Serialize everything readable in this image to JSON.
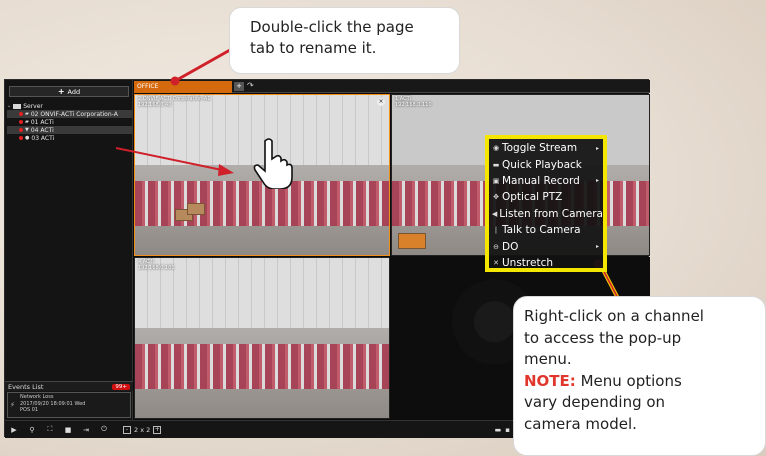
{
  "callouts": {
    "tab_hint": [
      "Double-click the page",
      "tab to rename it."
    ],
    "menu_hint": [
      "Right-click on a channel",
      "to access the pop-up",
      "menu."
    ],
    "note_label": "NOTE:",
    "note_text": [
      " Menu options",
      "vary depending on",
      "camera model."
    ]
  },
  "sidebar": {
    "add_label": "Add",
    "root_label": "Server",
    "devices": [
      {
        "label": "02 ONVIF-ACTi Corporation-A",
        "icon": "camera-icon"
      },
      {
        "label": "01 ACTi",
        "icon": "camera-icon"
      },
      {
        "label": "04 ACTi",
        "icon": "ptz-camera-icon"
      },
      {
        "label": "03 ACTi",
        "icon": "dome-camera-icon"
      }
    ]
  },
  "events": {
    "title": "Events List",
    "badge": "99+",
    "item": {
      "type": "Network Loss",
      "timestamp": "2017/09/20 18:09:01 Wed",
      "source": "POS 01"
    }
  },
  "tabs": {
    "active": "OFFICE",
    "add": "+",
    "refresh": "↷"
  },
  "channels": [
    {
      "label": "2 ONVIF-ACTi Corporation-A1",
      "sub": "192.168.0.40"
    },
    {
      "label": "1 ACTi",
      "sub": "192.168.0.110"
    },
    {
      "label": "4 ACTi",
      "sub": "192.168.0.101"
    }
  ],
  "context_menu": [
    {
      "label": "Toggle Stream",
      "icon": "stream-icon",
      "submenu": true
    },
    {
      "label": "Quick Playback",
      "icon": "playback-icon",
      "submenu": false
    },
    {
      "label": "Manual Record",
      "icon": "record-icon",
      "submenu": true
    },
    {
      "label": "Optical PTZ",
      "icon": "ptz-icon",
      "submenu": false
    },
    {
      "label": "Listen from Camera",
      "icon": "speaker-icon",
      "submenu": false
    },
    {
      "label": "Talk to Camera",
      "icon": "microphone-icon",
      "submenu": false
    },
    {
      "label": "DO",
      "icon": "digital-output-icon",
      "submenu": true
    },
    {
      "label": "Unstretch",
      "icon": "unstretch-icon",
      "submenu": false
    }
  ],
  "toolbar": {
    "layout_label": "2 x 2",
    "minus": "-",
    "plus": "+"
  },
  "colors": {
    "accent": "#d4690e",
    "highlight": "#f5e600",
    "note": "#e0362c",
    "pointer": "#d0202a"
  }
}
